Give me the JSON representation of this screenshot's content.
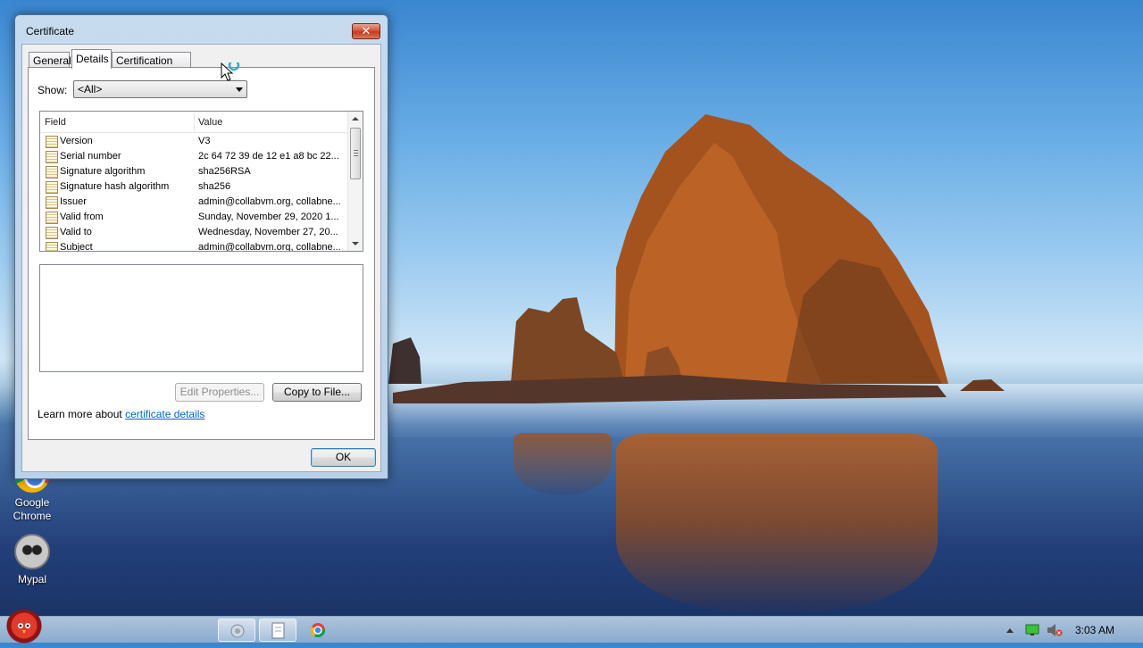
{
  "desktop": {
    "icons": [
      {
        "label": "Google\nChrome",
        "icon": "chrome-icon"
      },
      {
        "label": "Mypal",
        "icon": "raccoon-icon"
      }
    ]
  },
  "dialog": {
    "title": "Certificate",
    "close_label": "✕",
    "tabs": [
      "General",
      "Details",
      "Certification Path"
    ],
    "active_tab": "Details",
    "show_label": "Show:",
    "show_value": "<All>",
    "columns": {
      "field": "Field",
      "value": "Value"
    },
    "rows": [
      {
        "field": "Version",
        "value": "V3"
      },
      {
        "field": "Serial number",
        "value": "2c 64 72 39 de 12 e1 a8 bc 22..."
      },
      {
        "field": "Signature algorithm",
        "value": "sha256RSA"
      },
      {
        "field": "Signature hash algorithm",
        "value": "sha256"
      },
      {
        "field": "Issuer",
        "value": "admin@collabvm.org, collabne..."
      },
      {
        "field": "Valid from",
        "value": "Sunday, November 29, 2020 1..."
      },
      {
        "field": "Valid to",
        "value": "Wednesday, November 27, 20..."
      },
      {
        "field": "Subject",
        "value": "admin@collabvm.org, collabne..."
      }
    ],
    "edit_properties": "Edit Properties...",
    "copy_to_file": "Copy to File...",
    "learn_prefix": "Learn more about ",
    "learn_link": "certificate details",
    "ok": "OK"
  },
  "taskbar": {
    "clock": "3:03 AM"
  }
}
